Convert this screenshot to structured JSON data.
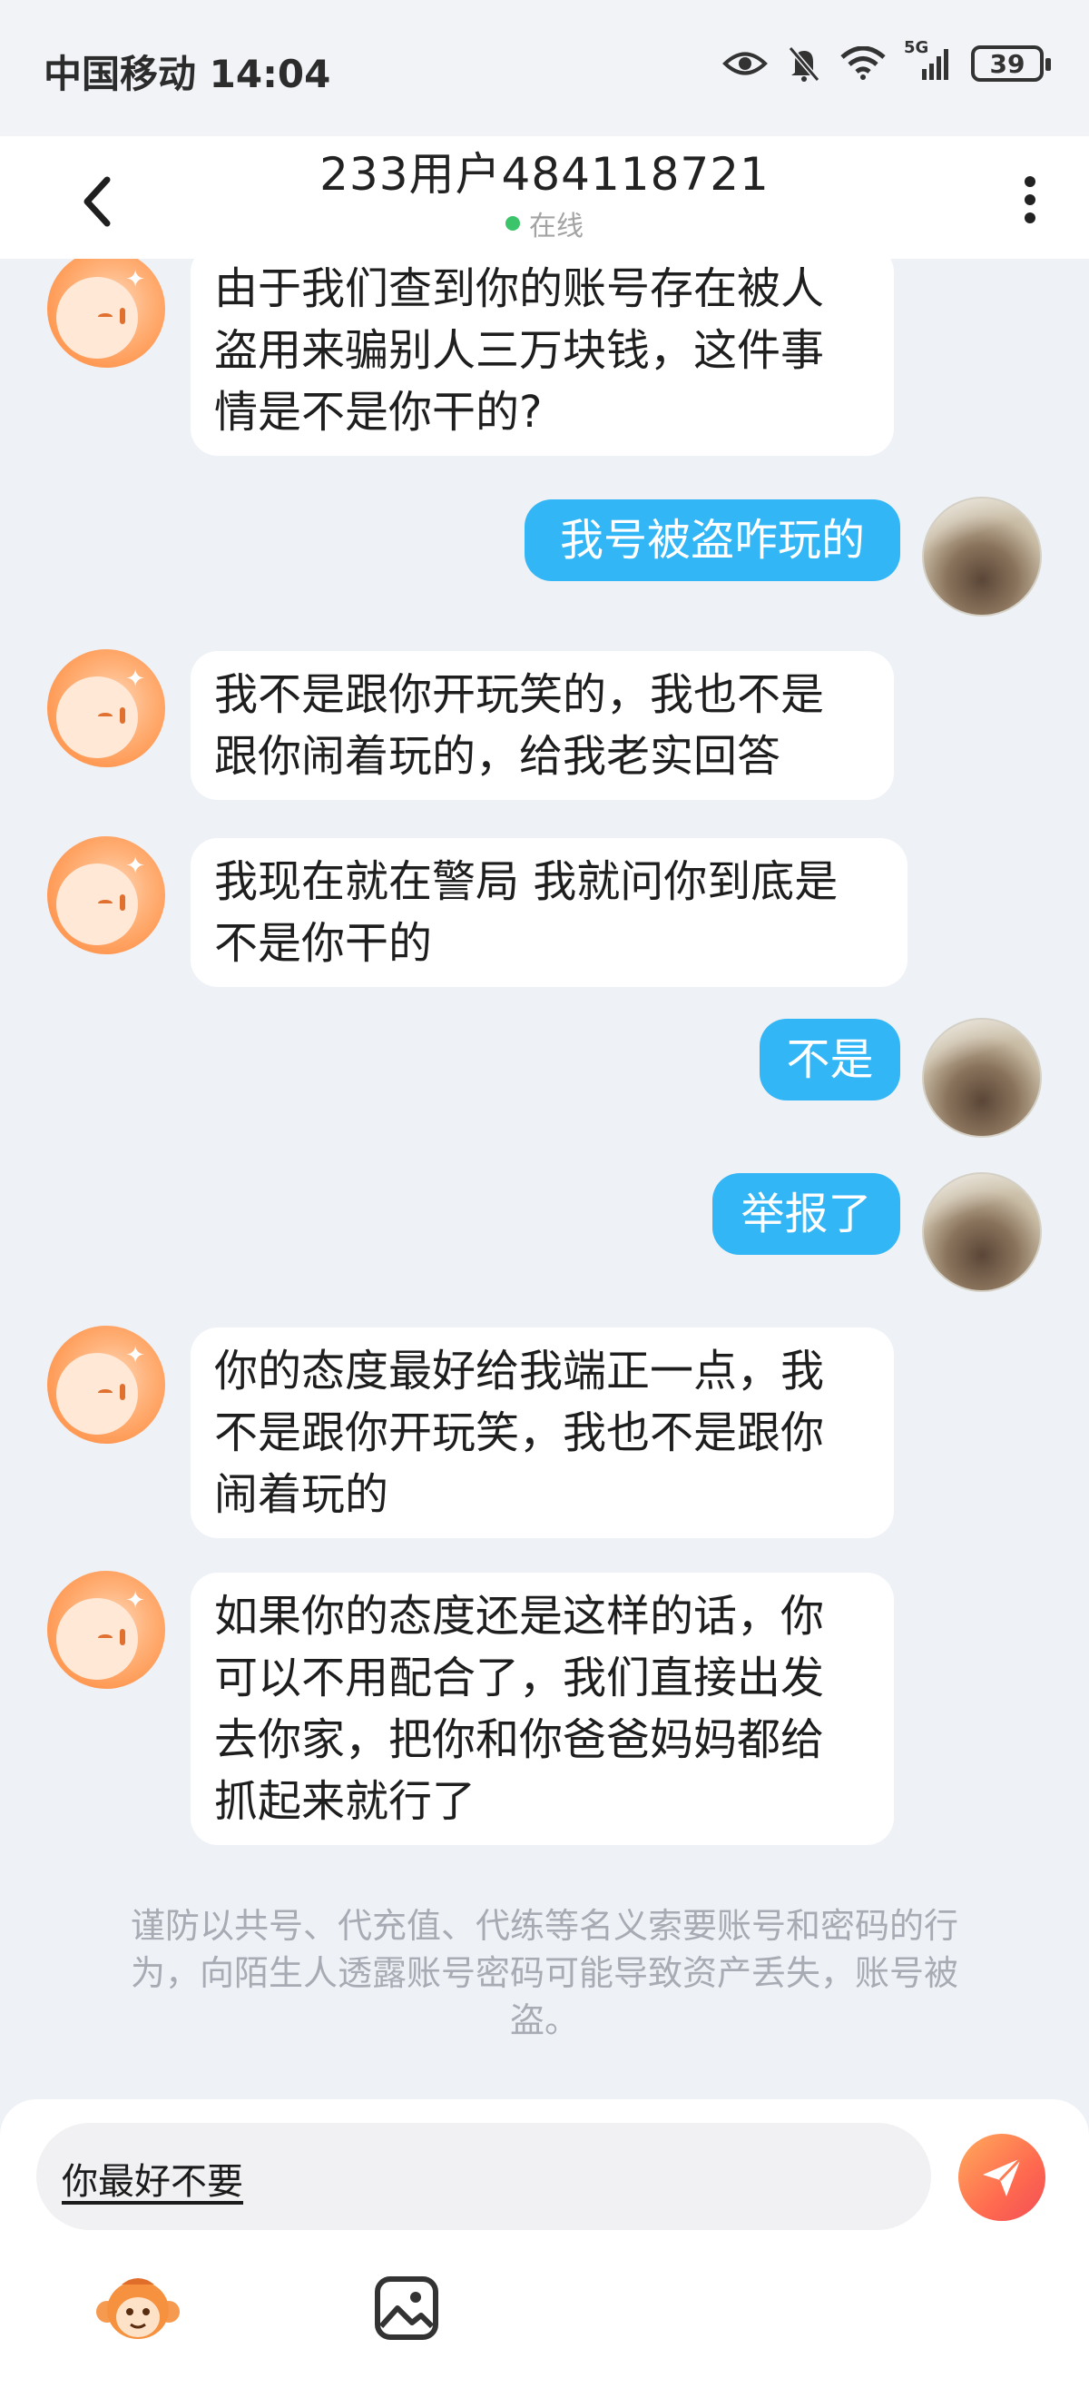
{
  "status_bar": {
    "carrier": "中国移动",
    "time": "14:04",
    "network": "5G",
    "battery": "39"
  },
  "header": {
    "title": "233用户484118721",
    "status": "在线"
  },
  "messages": [
    {
      "side": "left",
      "text": "由于我们查到你的账号存在被人\n盗用来骗别人三万块钱，这件事\n情是不是你干的?"
    },
    {
      "side": "right",
      "text": "我号被盗咋玩的"
    },
    {
      "side": "left",
      "text": "我不是跟你开玩笑的，我也不是\n跟你闹着玩的，给我老实回答"
    },
    {
      "side": "left",
      "text": "我现在就在警局 我就问你到底是\n不是你干的"
    },
    {
      "side": "right",
      "text": "不是"
    },
    {
      "side": "right",
      "text": "举报了"
    },
    {
      "side": "left",
      "text": "你的态度最好给我端正一点，我\n不是跟你开玩笑，我也不是跟你\n闹着玩的"
    },
    {
      "side": "left",
      "text": "如果你的态度还是这样的话，你\n可以不用配合了，我们直接出发\n去你家，把你和你爸爸妈妈都给\n抓起来就行了"
    }
  ],
  "notice": "谨防以共号、代充值、代练等名义索要账号和密码的行为，向陌生人透露账号密码可能导致资产丢失，账号被盗。",
  "input": {
    "value": "你最好不要"
  },
  "colors": {
    "outgoing_bubble": "#33b6f5",
    "incoming_bubble": "#ffffff",
    "background": "#eef1f6",
    "online": "#3cc46a",
    "send_gradient_start": "#ffab5c",
    "send_gradient_end": "#f24e55"
  },
  "icons": {
    "back": "chevron-left-icon",
    "more": "more-vertical-icon",
    "send": "paper-plane-icon",
    "sticker": "monkey-mascot-icon",
    "image": "image-icon"
  }
}
